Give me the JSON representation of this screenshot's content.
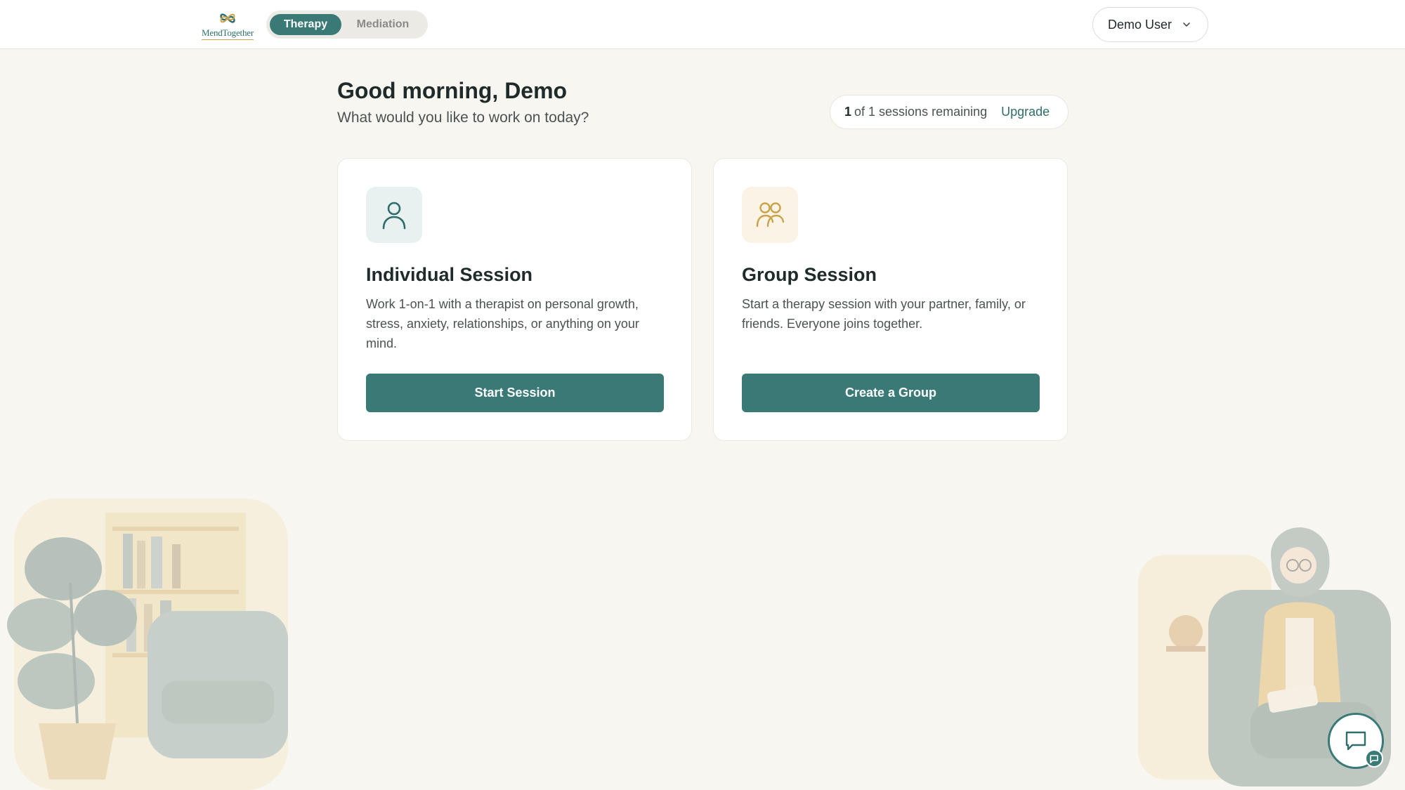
{
  "header": {
    "logo_text": "MendTogether",
    "modes": [
      {
        "label": "Therapy",
        "active": true
      },
      {
        "label": "Mediation",
        "active": false
      }
    ],
    "user_name": "Demo User",
    "user_menu_icon": "chevron-down-icon"
  },
  "greeting": {
    "title": "Good morning, Demo",
    "subtitle": "What would you like to work on today?"
  },
  "sessions": {
    "count": "1",
    "text": "of 1 sessions remaining",
    "upgrade_label": "Upgrade"
  },
  "cards": [
    {
      "icon": "person-icon",
      "title": "Individual Session",
      "description": "Work 1-on-1 with a therapist on personal growth, stress, anxiety, relationships, or anything on your mind.",
      "button_label": "Start Session"
    },
    {
      "icon": "group-icon",
      "title": "Group Session",
      "description": "Start a therapy session with your partner, family, or friends. Everyone joins together.",
      "button_label": "Create a Group"
    }
  ],
  "chat": {
    "icon": "chat-icon"
  },
  "colors": {
    "accent": "#3a7a76",
    "background": "#f8f6f1",
    "gold": "#c9a24a"
  }
}
